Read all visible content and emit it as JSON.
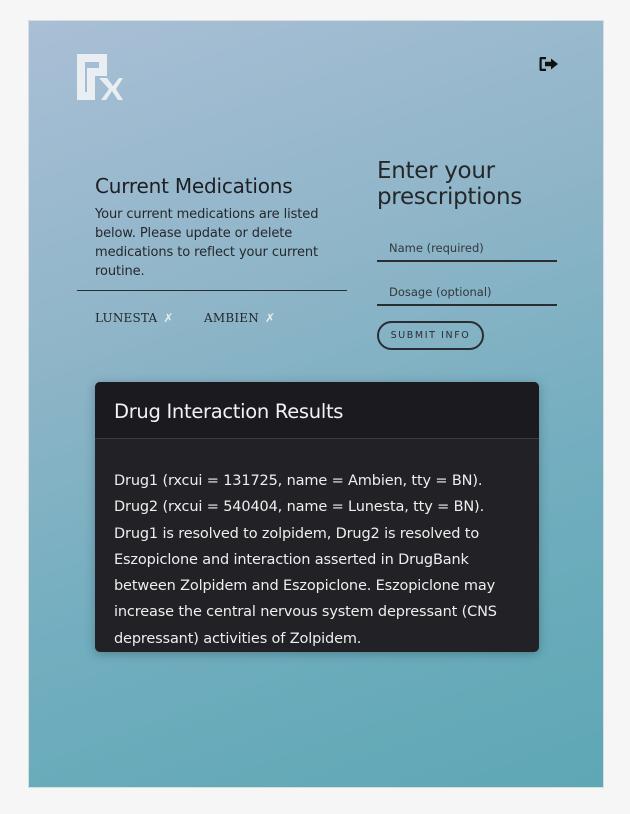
{
  "header": {
    "logo_icon": "rx-logo",
    "logout_icon": "sign-out-icon"
  },
  "current_medications": {
    "title": "Current Medications",
    "description": "Your current medications are listed below. Please update or delete medications to reflect your current routine.",
    "items": [
      {
        "label": "LUNESTA",
        "remove_glyph": "✗"
      },
      {
        "label": "AMBIEN",
        "remove_glyph": "✗"
      }
    ]
  },
  "prescription_form": {
    "title": "Enter your prescriptions",
    "name_placeholder": "Name (required)",
    "dosage_placeholder": "Dosage (optional)",
    "submit_label": "SUBMIT INFO"
  },
  "results": {
    "title": "Drug Interaction Results",
    "body": "Drug1 (rxcui = 131725, name = Ambien, tty = BN). Drug2 (rxcui = 540404, name = Lunesta, tty = BN). Drug1 is resolved to zolpidem, Drug2 is resolved to Eszopiclone and interaction asserted in DrugBank between Zolpidem and Eszopiclone. Eszopiclone may increase the central nervous system depressant (CNS depressant) activities of Zolpidem."
  },
  "colors": {
    "gradient_start": "#a9bfd6",
    "gradient_end": "#5ea7b4",
    "panel_bg": "#222226",
    "text_dark": "#25282b"
  }
}
